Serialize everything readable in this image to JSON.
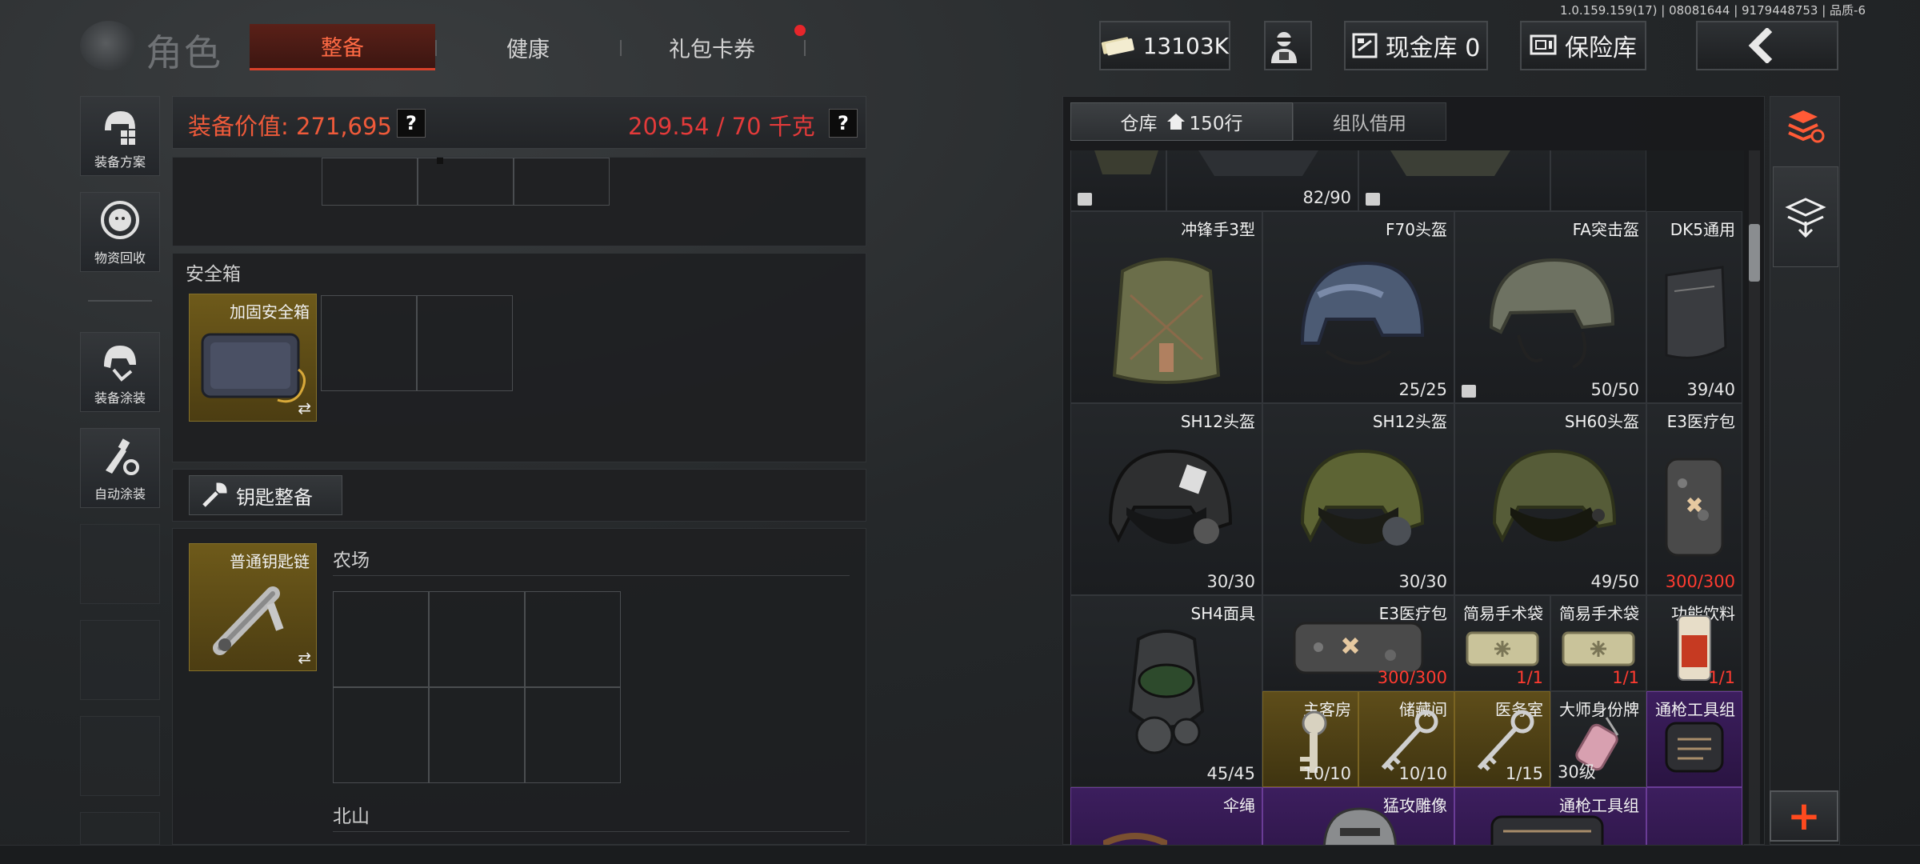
{
  "version": "1.0.159.159(17) | 08081644 | 9179448753 | 品质-6",
  "header": {
    "title": "角色",
    "tabs": [
      {
        "label": "整备",
        "active": true
      },
      {
        "label": "健康",
        "active": false
      },
      {
        "label": "礼包卡券",
        "active": false,
        "badge": true
      }
    ],
    "currency": "13103K",
    "cash_vault_label": "现金库 0",
    "insurance_label": "保险库"
  },
  "sidebar": {
    "items": [
      {
        "label": "装备方案",
        "icon": "equipment-plan-icon"
      },
      {
        "label": "物资回收",
        "icon": "recycle-icon"
      },
      {
        "label": "装备涂装",
        "icon": "paint-helmet-icon"
      },
      {
        "label": "自动涂装",
        "icon": "auto-paint-icon"
      }
    ]
  },
  "loadout": {
    "value_label": "装备价值: 271,695",
    "weight_label": "209.54 / 70 千克",
    "help_label": "?",
    "safe_box_section": "安全箱",
    "safe_box_item": "加固安全箱",
    "key_section_button": "钥匙整备",
    "keychain_item": "普通钥匙链",
    "area_farm": "农场",
    "area_north": "北山"
  },
  "warehouse": {
    "tab_label": "仓库",
    "tab_rows": "150行",
    "borrow_tab": "组队借用",
    "items": [
      {
        "name": "",
        "count": "",
        "type": "vest"
      },
      {
        "name": "",
        "count": "82/90",
        "type": "vest"
      },
      {
        "name": "",
        "count": "",
        "type": "vest"
      },
      {
        "name": "",
        "count": "",
        "type": "vest"
      },
      {
        "name": "冲锋手3型",
        "count": "",
        "type": "bag"
      },
      {
        "name": "F70头盔",
        "count": "25/25",
        "type": "helmet-camo"
      },
      {
        "name": "FA突击盔",
        "count": "50/50",
        "type": "helmet-olive"
      },
      {
        "name": "DK5通用",
        "count": "39/40",
        "type": "armor-plate"
      },
      {
        "name": "SH12头盔",
        "count": "30/30",
        "type": "helmet-black"
      },
      {
        "name": "SH12头盔",
        "count": "30/30",
        "type": "helmet-green"
      },
      {
        "name": "SH60头盔",
        "count": "49/50",
        "type": "helmet-green"
      },
      {
        "name": "E3医疗包",
        "count": "300/300",
        "type": "medkit"
      },
      {
        "name": "SH4面具",
        "count": "45/45",
        "type": "gasmask"
      },
      {
        "name": "E3医疗包",
        "count": "300/300",
        "type": "medkit-wide"
      },
      {
        "name": "简易手术袋",
        "count": "1/1",
        "type": "surgery"
      },
      {
        "name": "简易手术袋",
        "count": "1/1",
        "type": "surgery"
      },
      {
        "name": "功能饮料",
        "count": "1/1",
        "type": "drink"
      },
      {
        "name": "主客房",
        "count": "10/10",
        "type": "key"
      },
      {
        "name": "储藏间",
        "count": "10/10",
        "type": "key"
      },
      {
        "name": "医务室",
        "count": "1/15",
        "type": "key"
      },
      {
        "name": "大师身份牌",
        "count": "30级",
        "type": "tag"
      },
      {
        "name": "通枪工具组",
        "count": "",
        "type": "toolkit"
      },
      {
        "name": "伞绳",
        "count": "",
        "type": "rope"
      },
      {
        "name": "猛攻雕像",
        "count": "",
        "type": "statue"
      },
      {
        "name": "通枪工具组",
        "count": "",
        "type": "toolkit"
      }
    ]
  },
  "colors": {
    "accent": "#ff5a36",
    "gold_rarity": "#5e4d1a",
    "purple_rarity": "#3c1e5e",
    "warning_red": "#ff3b30"
  }
}
